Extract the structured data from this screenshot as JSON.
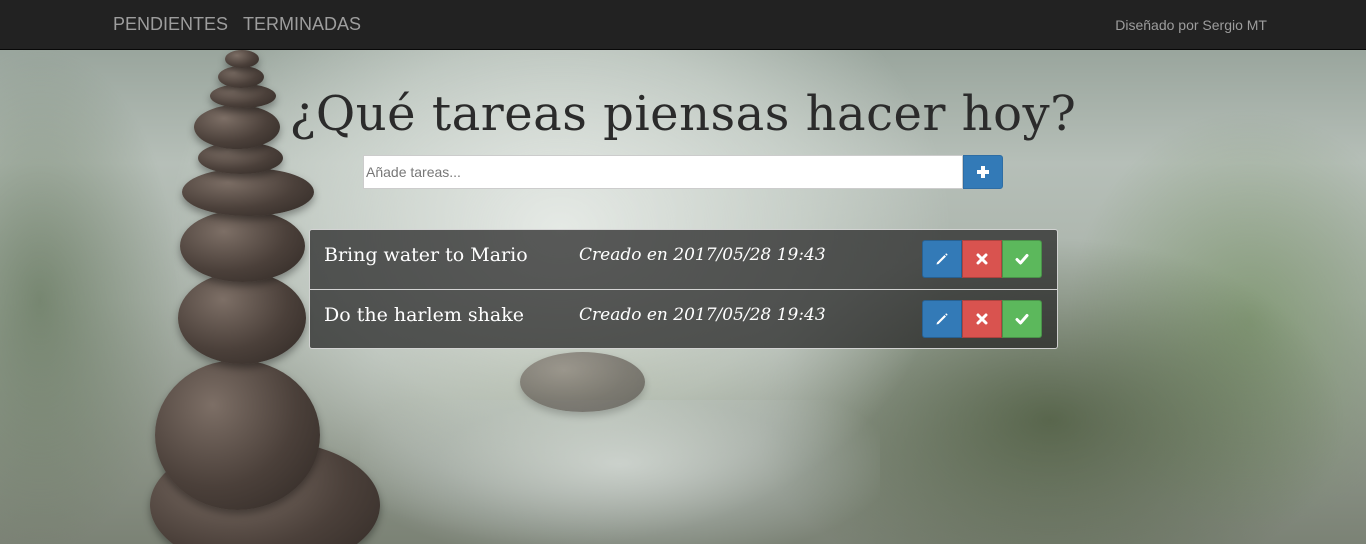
{
  "navbar": {
    "links": [
      {
        "label": "PENDIENTES"
      },
      {
        "label": "TERMINADAS"
      }
    ],
    "credit": "Diseñado por Sergio MT"
  },
  "main": {
    "title": "¿Qué tareas piensas hacer hoy?",
    "input": {
      "placeholder": "Añade tareas...",
      "value": ""
    },
    "add_button_icon": "plus-icon"
  },
  "tasks": [
    {
      "name": "Bring water to Mario",
      "created": "Creado en 2017/05/28 19:43"
    },
    {
      "name": "Do the harlem shake",
      "created": "Creado en 2017/05/28 19:43"
    }
  ],
  "task_actions": {
    "edit_icon": "pencil-icon",
    "delete_icon": "close-icon",
    "complete_icon": "check-icon"
  },
  "colors": {
    "navbar": "#222222",
    "primary": "#337ab7",
    "danger": "#d9534f",
    "success": "#5cb85c"
  }
}
